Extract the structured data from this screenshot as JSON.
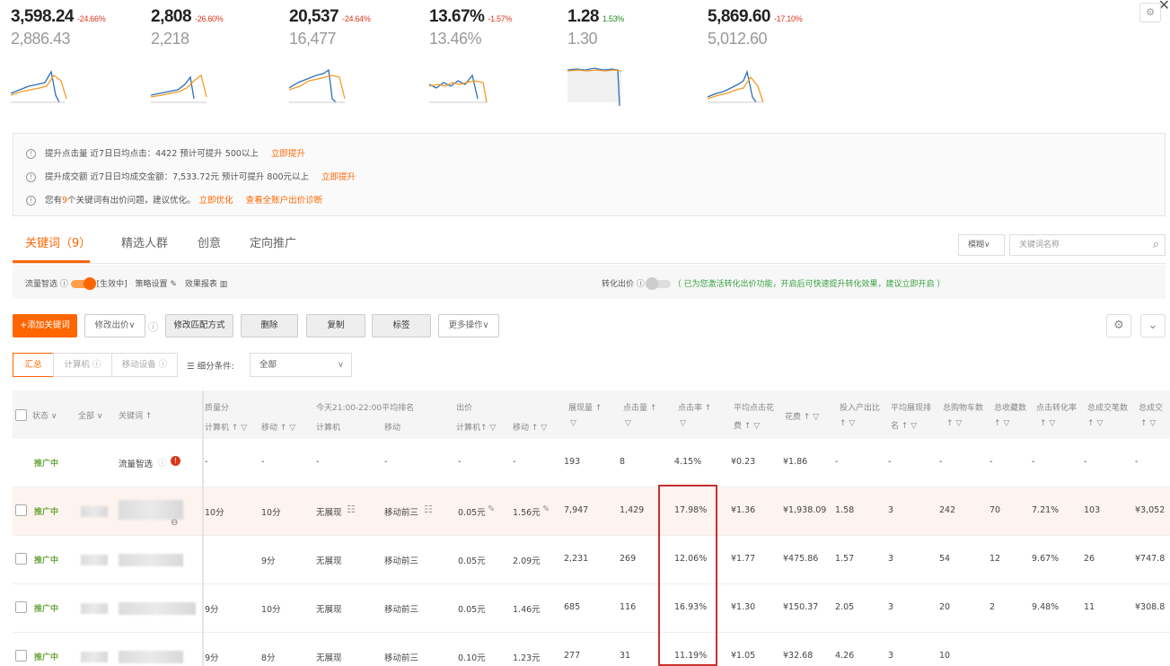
{
  "metrics": [
    {
      "value": "3,598.24",
      "change": "-24.66%",
      "prev": "2,886.43",
      "dir": "down"
    },
    {
      "value": "2,808",
      "change": "-26.60%",
      "prev": "2,218",
      "dir": "down"
    },
    {
      "value": "20,537",
      "change": "-24.64%",
      "prev": "16,477",
      "dir": "down"
    },
    {
      "value": "13.67%",
      "change": "-1.57%",
      "prev": "13.46%",
      "dir": "down"
    },
    {
      "value": "1.28",
      "change": "1.53%",
      "prev": "1.30",
      "dir": "up"
    },
    {
      "value": "5,869.60",
      "change": "-17.10%",
      "prev": "5,012.60",
      "dir": "down"
    }
  ],
  "colors": {
    "accent": "#ff6600",
    "series_current": "#2f6fb8",
    "series_previous": "#f59a23",
    "status_green": "#6aa53a",
    "highlight_box": "#c9302c"
  },
  "notices": [
    {
      "text": "提升点击量 近7日日均点击：4422   预计可提升 500以上",
      "link": "立即提升"
    },
    {
      "text": "提升成交额 近7日日均成交金额：7,533.72元   预计可提升 800元以上",
      "link": "立即提升"
    },
    {
      "pre": "您有",
      "count": "9",
      "post": "个关键词有出价问题，建议优化。",
      "link": "立即优化",
      "link2": "查看全账户出价诊断"
    }
  ],
  "tabs": [
    "关键词（9）",
    "精选人群",
    "创意",
    "定向推广"
  ],
  "search": {
    "match": "模糊∨",
    "placeholder": "关键词名称"
  },
  "strategy": {
    "smart_label": "流量智选 ⓘ",
    "smart_state": "[生效中]",
    "settings": "策略设置",
    "report": "效果报表",
    "conv_label": "转化出价 ⓘ",
    "conv_note": "（ 已为您激活转化出价功能，开启后可快速提升转化效果，建议立即开启 ）"
  },
  "toolbar": {
    "add": "+添加关键词",
    "bid": "修改出价∨",
    "match": "修改匹配方式",
    "delete": "删除",
    "copy": "复制",
    "tag": "标签",
    "more": "更多操作∨"
  },
  "segments": {
    "summary": "汇总",
    "pc": "计算机 ⓘ",
    "mobile": "移动设备 ⓘ",
    "filter_label": "细分条件:",
    "filter_value": "全部"
  },
  "headers": {
    "status": "状态 ∨",
    "all": "全部 ∨",
    "keyword": "关键词 ↑",
    "quality": "质量分",
    "quality_pc": "计算机 ↑ ▽",
    "quality_mobile": "移动 ↑ ▽",
    "rank": "今天21:00-22:00平均排名",
    "rank_pc": "计算机",
    "rank_mobile": "移动",
    "bid": "出价",
    "bid_pc": "计算机↑ ▽",
    "bid_mobile": "移动 ↑ ▽",
    "impr": "展现量 ↑",
    "clicks": "点击量 ↑",
    "ctr": "点击率 ↑",
    "cpc": "平均点击花",
    "cpc2": "费 ↑ ▽",
    "cost": "花费 ↑ ▽",
    "roi": "投入产出比",
    "avg_rank": "平均展现排",
    "avg_rank2": "名 ↑ ▽",
    "cart": "总购物车数",
    "fav": "总收藏数",
    "cvr": "点击转化率",
    "orders": "总成交笔数",
    "gmv": "总成交",
    "filter": "▽",
    "sort": "↑ ▽"
  },
  "rows": [
    {
      "status": "推广中",
      "keyword": "流量智选",
      "q_pc": "-",
      "q_mob": "-",
      "r_pc": "-",
      "r_mob": "-",
      "b_pc": "-",
      "b_mob": "-",
      "impr": "193",
      "clicks": "8",
      "ctr": "4.15%",
      "cpc": "¥0.23",
      "cost": "¥1.86",
      "roi": "-",
      "avg_rank": "-",
      "cart": "-",
      "fav": "-",
      "cvr": "-",
      "orders": "-",
      "gmv": "-"
    },
    {
      "status": "推广中",
      "keyword": "",
      "q_pc": "10分",
      "q_mob": "10分",
      "r_pc": "无展现",
      "r_mob": "移动前三",
      "b_pc": "0.05元",
      "b_mob": "1.56元",
      "impr": "7,947",
      "clicks": "1,429",
      "ctr": "17.98%",
      "cpc": "¥1.36",
      "cost": "¥1,938.09",
      "roi": "1.58",
      "avg_rank": "3",
      "cart": "242",
      "fav": "70",
      "cvr": "7.21%",
      "orders": "103",
      "gmv": "¥3,052"
    },
    {
      "status": "推广中",
      "keyword": "",
      "q_pc": "",
      "q_mob": "9分",
      "r_pc": "无展现",
      "r_mob": "移动前三",
      "b_pc": "0.05元",
      "b_mob": "2.09元",
      "impr": "2,231",
      "clicks": "269",
      "ctr": "12.06%",
      "cpc": "¥1.77",
      "cost": "¥475.86",
      "roi": "1.57",
      "avg_rank": "3",
      "cart": "54",
      "fav": "12",
      "cvr": "9.67%",
      "orders": "26",
      "gmv": "¥747.8"
    },
    {
      "status": "推广中",
      "keyword": "",
      "q_pc": "9分",
      "q_mob": "10分",
      "r_pc": "无展现",
      "r_mob": "移动前三",
      "b_pc": "0.05元",
      "b_mob": "1.46元",
      "impr": "685",
      "clicks": "116",
      "ctr": "16.93%",
      "cpc": "¥1.30",
      "cost": "¥150.37",
      "roi": "2.05",
      "avg_rank": "3",
      "cart": "20",
      "fav": "2",
      "cvr": "9.48%",
      "orders": "11",
      "gmv": "¥308.8"
    },
    {
      "status": "推广中",
      "keyword": "",
      "q_pc": "9分",
      "q_mob": "8分",
      "r_pc": "无展现",
      "r_mob": "移动前三",
      "b_pc": "0.10元",
      "b_mob": "1.23元",
      "impr": "277",
      "clicks": "31",
      "ctr": "11.19%",
      "cpc": "¥1.05",
      "cost": "¥32.68",
      "roi": "4.26",
      "avg_rank": "3",
      "cart": "10",
      "fav": "",
      "cvr": "",
      "orders": "",
      "gmv": ""
    }
  ]
}
